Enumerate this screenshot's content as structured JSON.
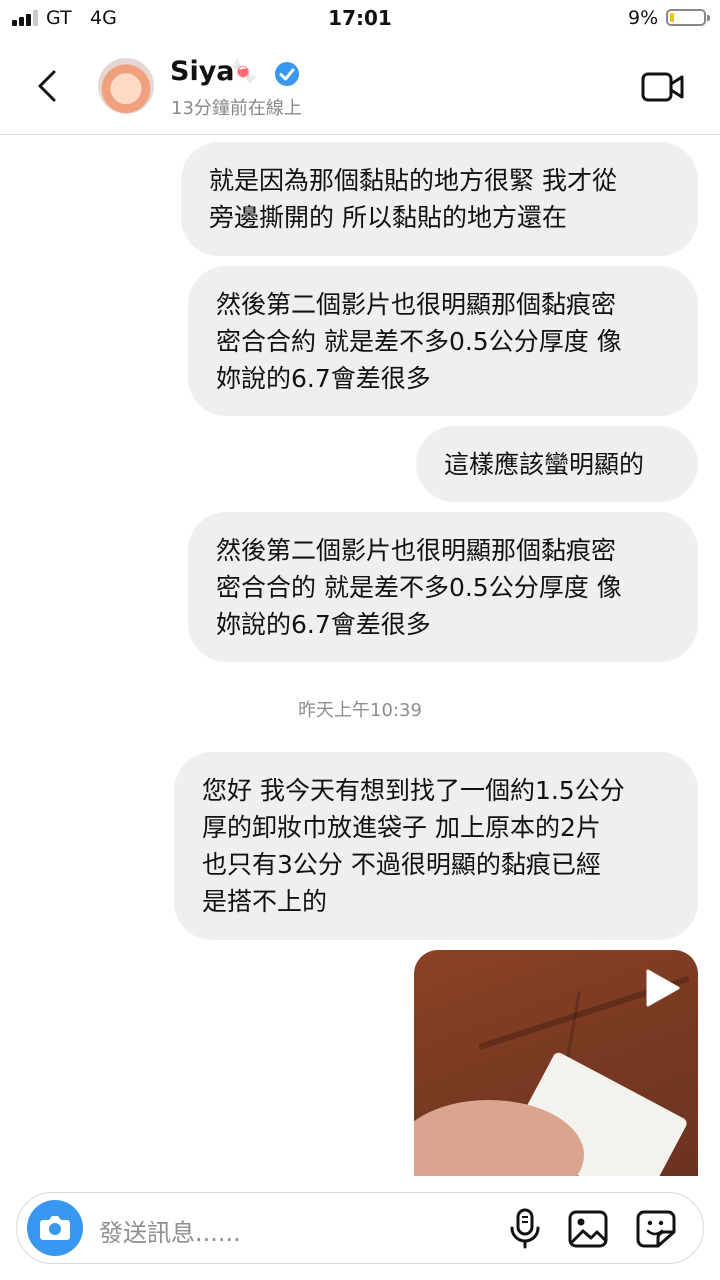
{
  "status_bar": {
    "carrier": "GT",
    "network": "4G",
    "time": "17:01",
    "battery_percent": "9%",
    "battery_level": 0.09
  },
  "header": {
    "contact_name": "Siya",
    "name_emoji": "🍬",
    "last_seen": "13分鐘前在線上"
  },
  "messages": [
    {
      "side": "out",
      "text": "就是因為那個黏貼的地方很緊 我才從\n旁邊撕開的 所以黏貼的地方還在"
    },
    {
      "side": "out",
      "text": "然後第二個影片也很明顯那個黏痕密\n密合合約 就是差不多0.5公分厚度 像\n妳說的6.7會差很多"
    },
    {
      "side": "out",
      "text": "這樣應該蠻明顯的"
    },
    {
      "side": "out",
      "text": "然後第二個影片也很明顯那個黏痕密\n密合合的 就是差不多0.5公分厚度 像\n妳說的6.7會差很多"
    },
    {
      "side": "out",
      "text": "您好 我今天有想到找了一個約1.5公分\n厚的卸妝巾放進袋子 加上原本的2片\n也只有3公分 不過很明顯的黏痕已經\n是搭不上的"
    }
  ],
  "timestamp": "昨天上午10:39",
  "composer": {
    "placeholder": "發送訊息......"
  },
  "colors": {
    "accent": "#3897f0",
    "bubble": "#efefef",
    "verified": "#3897f0"
  }
}
